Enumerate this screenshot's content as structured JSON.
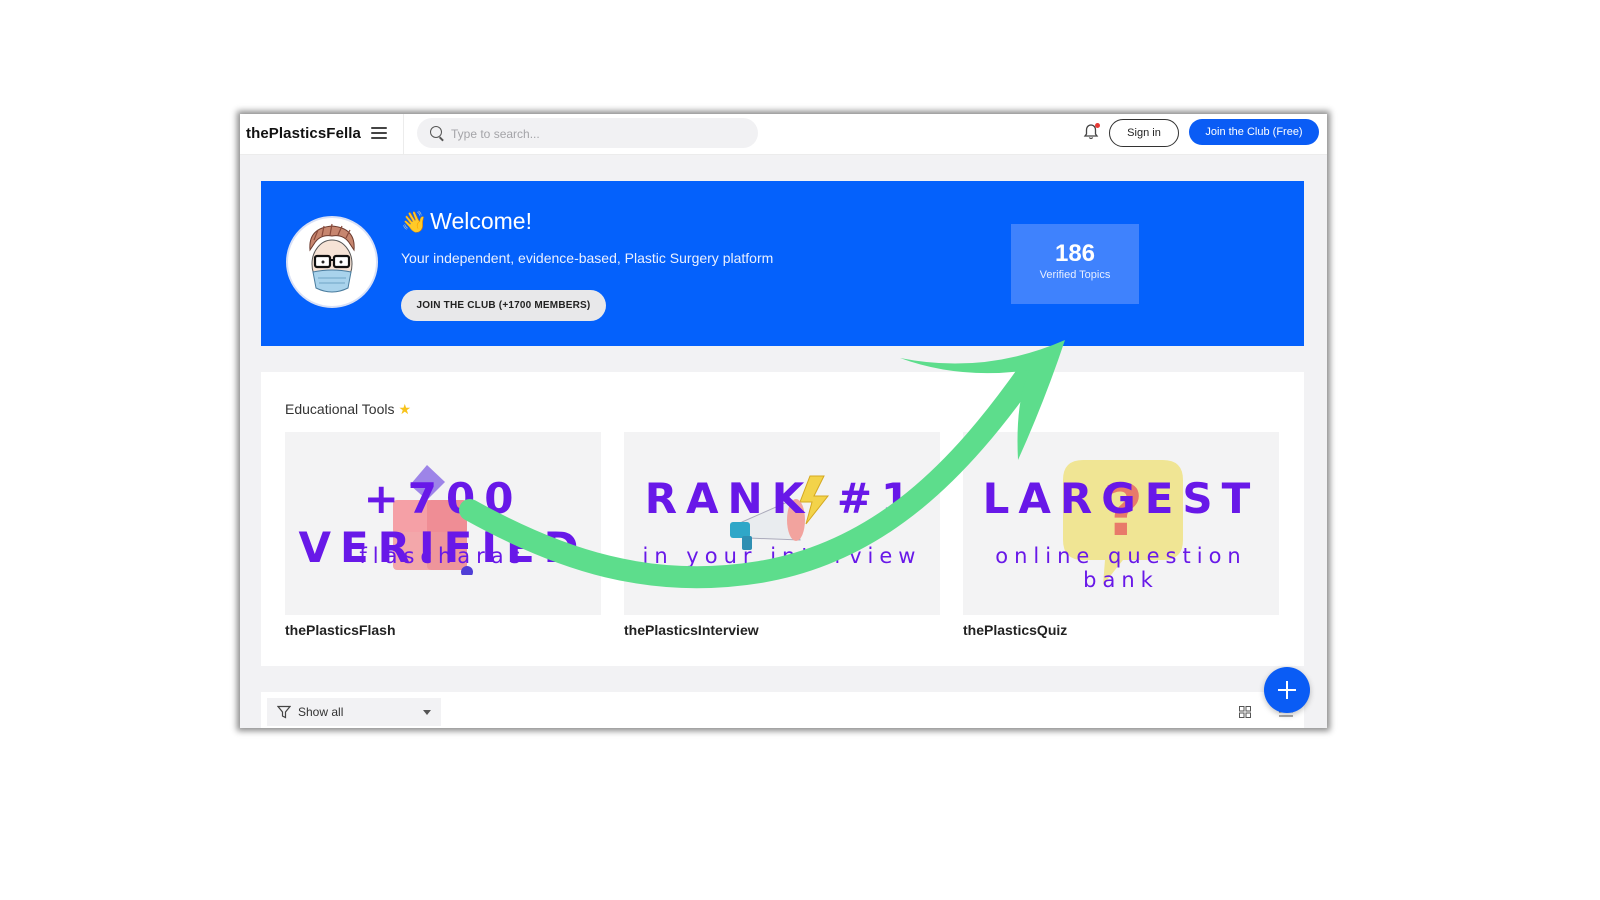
{
  "header": {
    "brand": "thePlasticsFella",
    "search_placeholder": "Type to search...",
    "sign_in": "Sign in",
    "join_free": "Join the Club (Free)"
  },
  "banner": {
    "wave_emoji": "👋",
    "title": "Welcome!",
    "tagline": "Your independent, evidence-based, Plastic Surgery platform",
    "join_button": "JOIN THE CLUB (+1700 MEMBERS)",
    "stat_value": "186",
    "stat_label": "Verified Topics"
  },
  "tools": {
    "title": "Educational Tools",
    "star": "★",
    "cards": [
      {
        "headline": "+700 VERIFIED",
        "subline": "flascharas",
        "name": "thePlasticsFlash",
        "icon": "flashcards-icon"
      },
      {
        "headline": "RANK #1",
        "subline": "in your interview",
        "name": "thePlasticsInterview",
        "icon": "megaphone-icon"
      },
      {
        "headline": "LARGEST",
        "subline": "online question bank",
        "name": "thePlasticsQuiz",
        "icon": "question-bubble-icon"
      }
    ]
  },
  "filter": {
    "selected": "Show all"
  },
  "colors": {
    "primary": "#0a5cf5",
    "banner": "#0461fc",
    "stat_box": "#3f82fd",
    "accent_text": "#6818e8",
    "arrow": "#5ddd8c"
  }
}
